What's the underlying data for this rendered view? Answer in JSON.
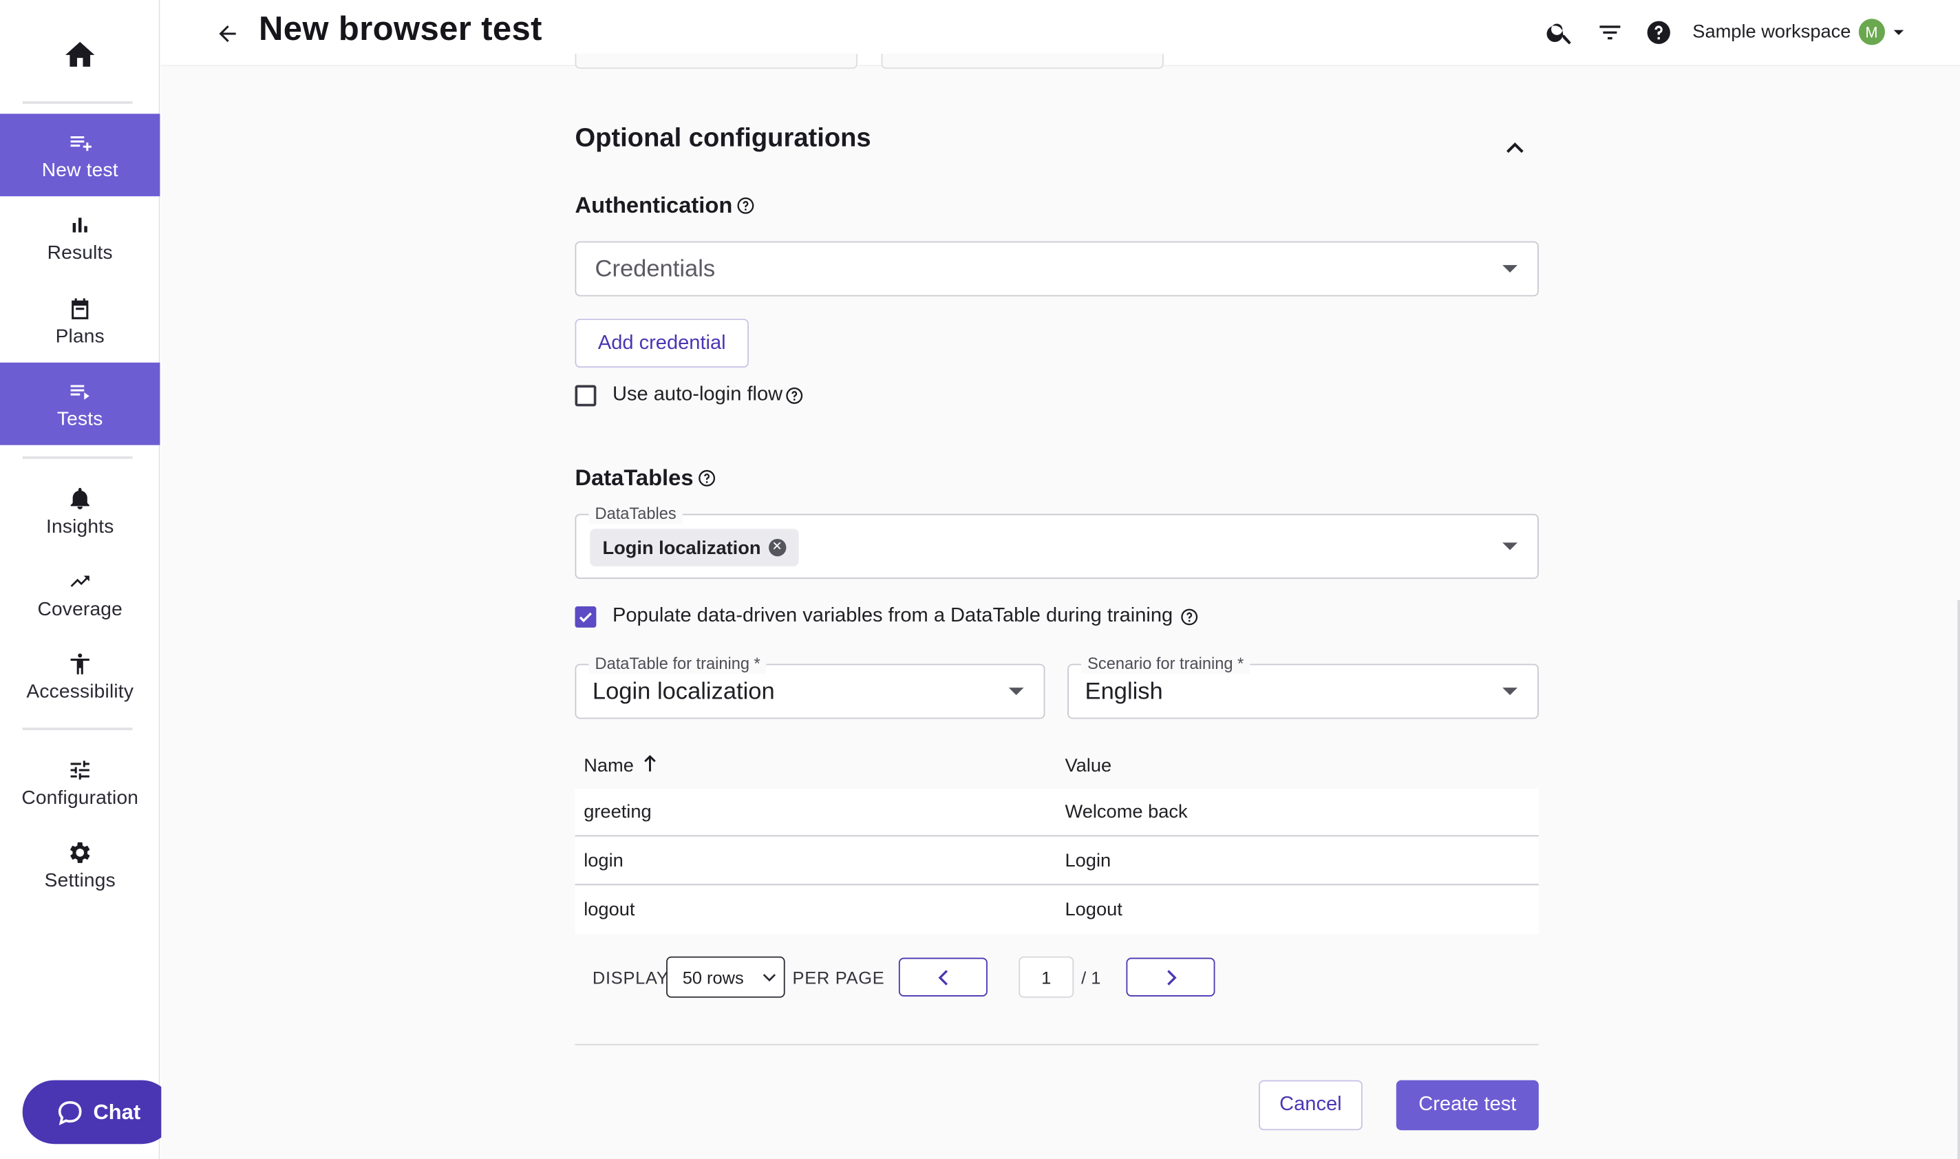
{
  "sidebar": {
    "items": [
      {
        "label": "New test",
        "icon": "playlist-add-icon"
      },
      {
        "label": "Results",
        "icon": "bar-chart-icon"
      },
      {
        "label": "Plans",
        "icon": "calendar-icon"
      },
      {
        "label": "Tests",
        "icon": "playlist-play-icon"
      },
      {
        "label": "Insights",
        "icon": "bell-icon"
      },
      {
        "label": "Coverage",
        "icon": "trending-up-icon"
      },
      {
        "label": "Accessibility",
        "icon": "accessibility-icon"
      },
      {
        "label": "Configuration",
        "icon": "tune-icon"
      },
      {
        "label": "Settings",
        "icon": "gear-icon"
      }
    ],
    "chat_label": "Chat"
  },
  "header": {
    "title": "New browser test",
    "workspace_name": "Sample workspace",
    "avatar_initial": "M"
  },
  "optional": {
    "title": "Optional configurations",
    "authentication": {
      "title": "Authentication",
      "select_placeholder": "Credentials",
      "add_credential_label": "Add credential",
      "auto_login_label": "Use auto-login flow",
      "auto_login_checked": false
    },
    "datatables": {
      "title": "DataTables",
      "field_label": "DataTables",
      "selected_chip": "Login localization",
      "populate_label": "Populate data-driven variables from a DataTable during training",
      "populate_checked": true,
      "training_table_label": "DataTable for training *",
      "training_table_value": "Login localization",
      "scenario_label": "Scenario for training *",
      "scenario_value": "English"
    }
  },
  "table": {
    "headers": {
      "name": "Name",
      "value": "Value"
    },
    "rows": [
      {
        "name": "greeting",
        "value": "Welcome back"
      },
      {
        "name": "login",
        "value": "Login"
      },
      {
        "name": "logout",
        "value": "Logout"
      }
    ]
  },
  "pagination": {
    "display_label": "DISPLAY",
    "rows_value": "50 rows",
    "per_page_label": "PER PAGE",
    "current_page": "1",
    "total_pages": "/ 1"
  },
  "footer": {
    "cancel_label": "Cancel",
    "create_label": "Create test"
  },
  "colors": {
    "accent": "#6c5dd3",
    "chat": "#4a36b3",
    "avatar": "#6aa84f"
  }
}
